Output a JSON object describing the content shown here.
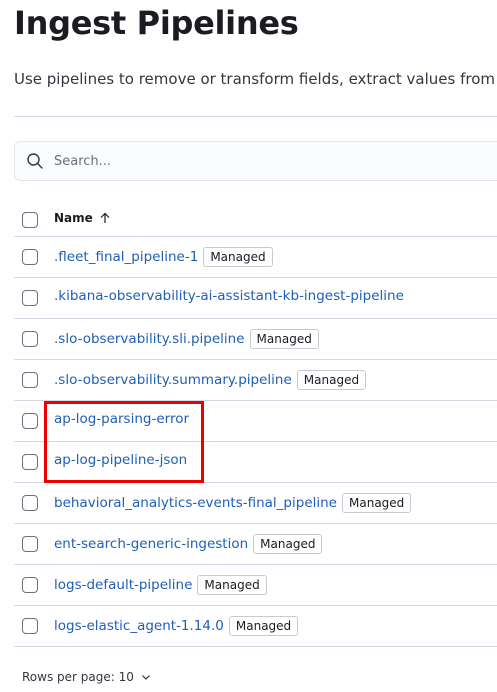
{
  "header": {
    "title": "Ingest Pipelines",
    "description": "Use pipelines to remove or transform fields, extract values from"
  },
  "search": {
    "placeholder": "Search..."
  },
  "table": {
    "name_column": "Name",
    "rows": [
      {
        "name": ".fleet_final_pipeline-1",
        "badge": "Managed"
      },
      {
        "name": ".kibana-observability-ai-assistant-kb-ingest-pipeline",
        "badge": ""
      },
      {
        "name": ".slo-observability.sli.pipeline",
        "badge": "Managed"
      },
      {
        "name": ".slo-observability.summary.pipeline",
        "badge": "Managed"
      },
      {
        "name": "ap-log-parsing-error",
        "badge": ""
      },
      {
        "name": "ap-log-pipeline-json",
        "badge": ""
      },
      {
        "name": "behavioral_analytics-events-final_pipeline",
        "badge": "Managed"
      },
      {
        "name": "ent-search-generic-ingestion",
        "badge": "Managed"
      },
      {
        "name": "logs-default-pipeline",
        "badge": "Managed"
      },
      {
        "name": "logs-elastic_agent-1.14.0",
        "badge": "Managed"
      }
    ]
  },
  "pagination": {
    "rows_per_page_label": "Rows per page: 10"
  },
  "colors": {
    "link": "#1f5fb5",
    "highlight": "#ee0000"
  }
}
